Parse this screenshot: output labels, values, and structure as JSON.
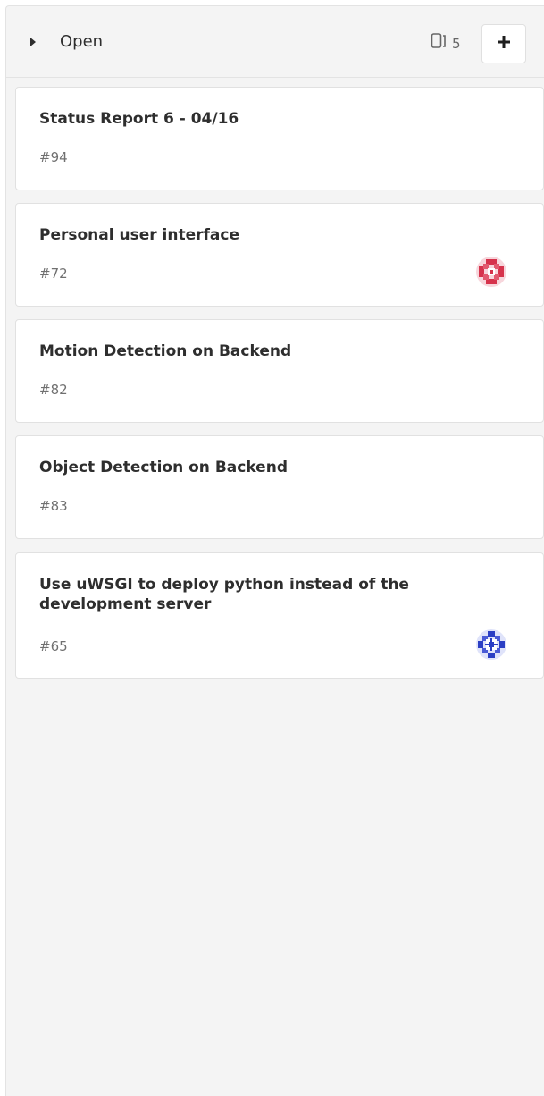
{
  "column": {
    "title": "Open",
    "issue_count": "5",
    "add_button_label": "+"
  },
  "cards": [
    {
      "title": "Status Report 6 - 04/16",
      "ref": "#94",
      "avatar": "none"
    },
    {
      "title": "Personal user interface",
      "ref": "#72",
      "avatar": "red-identicon"
    },
    {
      "title": "Motion Detection on Backend",
      "ref": "#82",
      "avatar": "none"
    },
    {
      "title": "Object Detection on Backend",
      "ref": "#83",
      "avatar": "none"
    },
    {
      "title": "Use uWSGI to deploy python instead of the development server",
      "ref": "#65",
      "avatar": "blue-identicon"
    }
  ],
  "colors": {
    "avatar_red": "#d6334c",
    "avatar_blue": "#2b3fc4"
  }
}
